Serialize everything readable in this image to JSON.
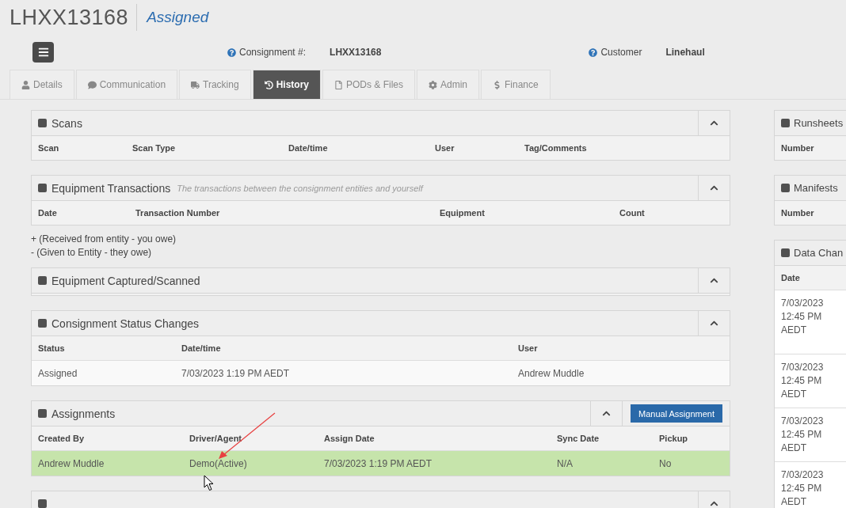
{
  "header": {
    "title": "LHXX13168",
    "status": "Assigned"
  },
  "info": [
    {
      "label": "Consignment #:",
      "value": "LHXX13168"
    },
    {
      "label": "Customer",
      "value": "Linehaul"
    }
  ],
  "tabs": [
    {
      "label": "Details",
      "selected": false
    },
    {
      "label": "Communication",
      "selected": false
    },
    {
      "label": "Tracking",
      "selected": false
    },
    {
      "label": "History",
      "selected": true
    },
    {
      "label": "PODs & Files",
      "selected": false
    },
    {
      "label": "Admin",
      "selected": false
    },
    {
      "label": "Finance",
      "selected": false
    }
  ],
  "panels": [
    {
      "title": "Scans",
      "expanded": true,
      "columns": [
        "Scan",
        "Scan Type",
        "Date/time",
        "User",
        "Tag/Comments"
      ]
    },
    {
      "title": "Equipment Transactions",
      "subtitle": "The transactions between the consignment entities and yourself",
      "expanded": true,
      "columns": [
        "Date",
        "Transaction Number",
        "Equipment",
        "Count"
      ],
      "notes": [
        "+ (Received from entity - you owe)",
        "- (Given to Entity - they owe)"
      ]
    },
    {
      "title": "Equipment Captured/Scanned",
      "expanded": true
    },
    {
      "title": "Consignment Status Changes",
      "expanded": true,
      "columns": [
        "Status",
        "Date/time",
        "User"
      ],
      "rows": [
        {
          "cells": [
            "Assigned",
            "7/03/2023 1:19 PM AEDT",
            "Andrew Muddle"
          ],
          "highlighted": false
        }
      ]
    },
    {
      "title": "Assignments",
      "expanded": true,
      "action": "Manual Assignment",
      "columns": [
        "Created By",
        "Driver/Agent",
        "Assign Date",
        "Sync Date",
        "Pickup"
      ],
      "rows": [
        {
          "cells": [
            "Andrew Muddle",
            "Demo(Active)",
            "7/03/2023 1:19 PM AEDT",
            "N/A",
            "No"
          ],
          "highlighted": true
        }
      ]
    },
    {
      "expanded": true
    }
  ],
  "side_panels": [
    {
      "title": "Runsheets",
      "columns": [
        "Number"
      ]
    },
    {
      "title": "Manifests",
      "columns": [
        "Number"
      ]
    },
    {
      "title": "Data Chan",
      "columns": [
        "Date"
      ],
      "rows": [
        {
          "cells": [
            "7/03/2023 12:45 PM AEDT"
          ]
        },
        {
          "cells": [
            "7/03/2023 12:45 PM AEDT"
          ]
        },
        {
          "cells": [
            "7/03/2023 12:45 PM AEDT"
          ]
        },
        {
          "cells": [
            "7/03/2023 12:45 PM AEDT"
          ]
        }
      ]
    }
  ]
}
